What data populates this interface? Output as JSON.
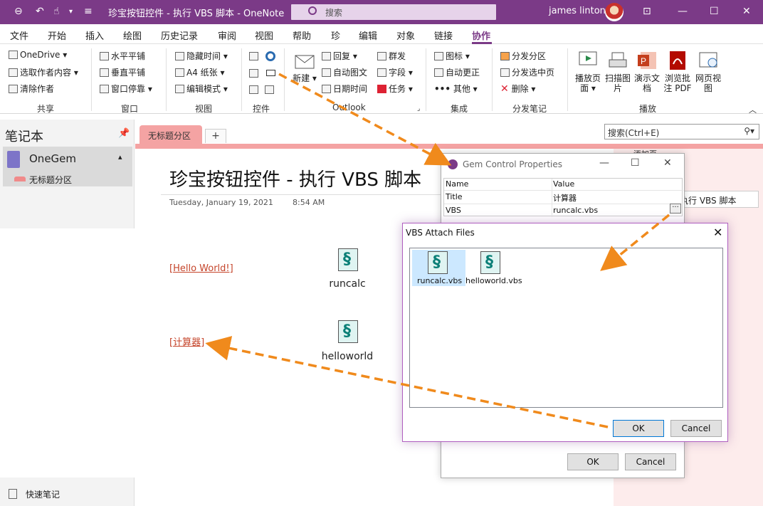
{
  "window": {
    "title": "珍宝按钮控件 - 执行 VBS 脚本  -  OneNote",
    "search_placeholder": "搜索",
    "user": "james linton"
  },
  "tabs": [
    "文件",
    "开始",
    "插入",
    "绘图",
    "历史记录",
    "审阅",
    "视图",
    "帮助",
    "珍",
    "编辑",
    "对象",
    "链接",
    "协作"
  ],
  "active_tab": "协作",
  "ribbon": {
    "share": {
      "items": [
        "OneDrive",
        "选取作者内容",
        "清除作者"
      ],
      "label": "共享"
    },
    "window": {
      "items": [
        "水平平铺",
        "垂直平铺",
        "窗口停靠"
      ],
      "label": "窗口"
    },
    "view": {
      "items": [
        "隐藏时间",
        "A4 纸张",
        "编辑模式"
      ],
      "label": "视图"
    },
    "controls": {
      "label": "控件"
    },
    "outlook": {
      "new": "新建",
      "items": [
        "回复",
        "自动图文",
        "日期时间",
        "群发",
        "字段",
        "任务"
      ],
      "label": "Outlook"
    },
    "integrate": {
      "items": [
        "图标",
        "自动更正",
        "其他"
      ],
      "label": "集成"
    },
    "distribute": {
      "items": [
        "分发分区",
        "分发选中页",
        "删除"
      ],
      "label": "分发笔记"
    },
    "play": {
      "items": [
        "播放页面",
        "扫描图片",
        "演示文档",
        "浏览批注 PDF",
        "网页视图"
      ],
      "label": "播放"
    }
  },
  "nav": {
    "title": "笔记本",
    "notebook": "OneGem",
    "section": "无标题分区",
    "quick_notes": "快速笔记"
  },
  "page": {
    "section_tab": "无标题分区",
    "add_tab": "+",
    "search_placeholder": "搜索(Ctrl+E)",
    "title": "珍宝按钮控件 - 执行 VBS 脚本",
    "date": "Tuesday, January 19, 2021",
    "time": "8:54 AM",
    "link_hello": "[Hello World!]",
    "link_calc": "[计算器]",
    "file1": "runcalc",
    "file2": "helloworld",
    "peek_tab": "添加页",
    "peek_page": "执行 VBS 脚本"
  },
  "gem_dialog": {
    "title": "Gem Control Properties",
    "col_name": "Name",
    "col_value": "Value",
    "rows": [
      {
        "name": "Title",
        "value": "计算器"
      },
      {
        "name": "VBS",
        "value": "runcalc.vbs"
      }
    ],
    "ok": "OK",
    "cancel": "Cancel"
  },
  "vbs_dialog": {
    "title": "VBS Attach Files",
    "files": [
      "runcalc.vbs",
      "helloworld.vbs"
    ],
    "ok": "OK",
    "cancel": "Cancel"
  },
  "colors": {
    "accent": "#7b3a87",
    "section": "#f4a3a3",
    "arrow": "#f08a1c"
  }
}
